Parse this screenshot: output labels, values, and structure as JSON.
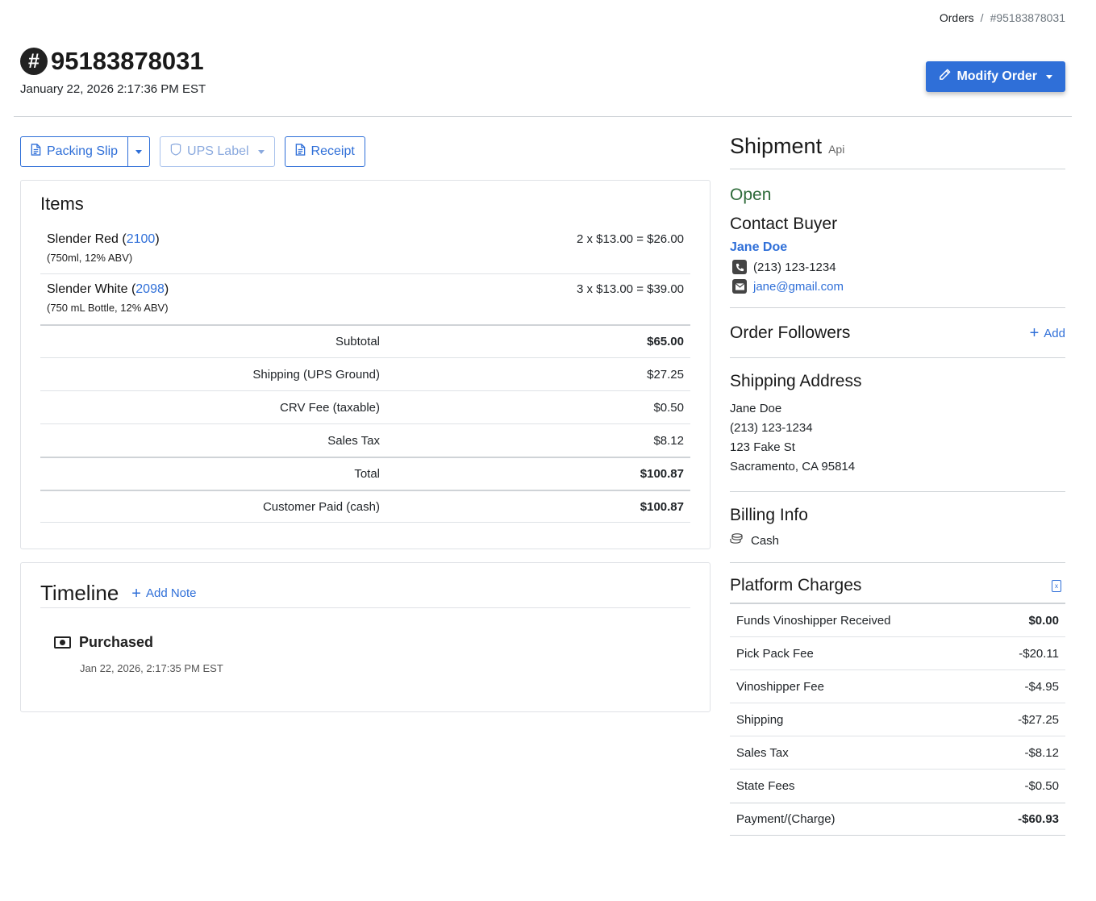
{
  "breadcrumb": {
    "root": "Orders",
    "separator": "/",
    "current": "#95183878031"
  },
  "order": {
    "number": "95183878031",
    "hash": "#",
    "date": "January 22, 2026 2:17:36 PM EST"
  },
  "modify_button": {
    "label": "Modify Order"
  },
  "actions": {
    "packing_slip": "Packing Slip",
    "ups_label": "UPS Label",
    "receipt": "Receipt"
  },
  "items": {
    "title": "Items",
    "rows": [
      {
        "name": "Slender Red",
        "sku": "2100",
        "detail": "(750ml, 12% ABV)",
        "price": "2 x $13.00 = $26.00"
      },
      {
        "name": "Slender White",
        "sku": "2098",
        "detail": "(750 mL Bottle, 12% ABV)",
        "price": "3 x $13.00 = $39.00"
      }
    ],
    "totals": [
      {
        "label": "Subtotal",
        "value": "$65.00"
      },
      {
        "label": "Shipping (UPS Ground)",
        "value": "$27.25"
      },
      {
        "label": "CRV Fee (taxable)",
        "value": "$0.50"
      },
      {
        "label": "Sales Tax",
        "value": "$8.12"
      },
      {
        "label": "Total",
        "value": "$100.87"
      },
      {
        "label": "Customer Paid (cash)",
        "value": "$100.87"
      }
    ]
  },
  "timeline": {
    "title": "Timeline",
    "add_note": "Add Note",
    "events": [
      {
        "title": "Purchased",
        "date": "Jan 22, 2026, 2:17:35 PM EST"
      }
    ]
  },
  "shipment": {
    "title": "Shipment",
    "source": "Api",
    "status": "Open"
  },
  "contact": {
    "title": "Contact Buyer",
    "name": "Jane Doe",
    "phone": "(213) 123-1234",
    "email": "jane@gmail.com"
  },
  "followers": {
    "title": "Order Followers",
    "add": "Add"
  },
  "shipping_address": {
    "title": "Shipping Address",
    "lines": [
      "Jane Doe",
      "(213) 123-1234",
      "123 Fake St",
      "Sacramento, CA 95814"
    ]
  },
  "billing": {
    "title": "Billing Info",
    "method": "Cash"
  },
  "platform": {
    "title": "Platform Charges",
    "rows": [
      {
        "label": "Funds Vinoshipper Received",
        "value": "$0.00"
      },
      {
        "label": "Pick Pack Fee",
        "value": "-$20.11"
      },
      {
        "label": "Vinoshipper Fee",
        "value": "-$4.95"
      },
      {
        "label": "Shipping",
        "value": "-$27.25"
      },
      {
        "label": "Sales Tax",
        "value": "-$8.12"
      },
      {
        "label": "State Fees",
        "value": "-$0.50"
      },
      {
        "label": "Payment/(Charge)",
        "value": "-$60.93"
      }
    ]
  },
  "colors": {
    "primary": "#2f6fd8",
    "status_open": "#2e6b3a"
  }
}
